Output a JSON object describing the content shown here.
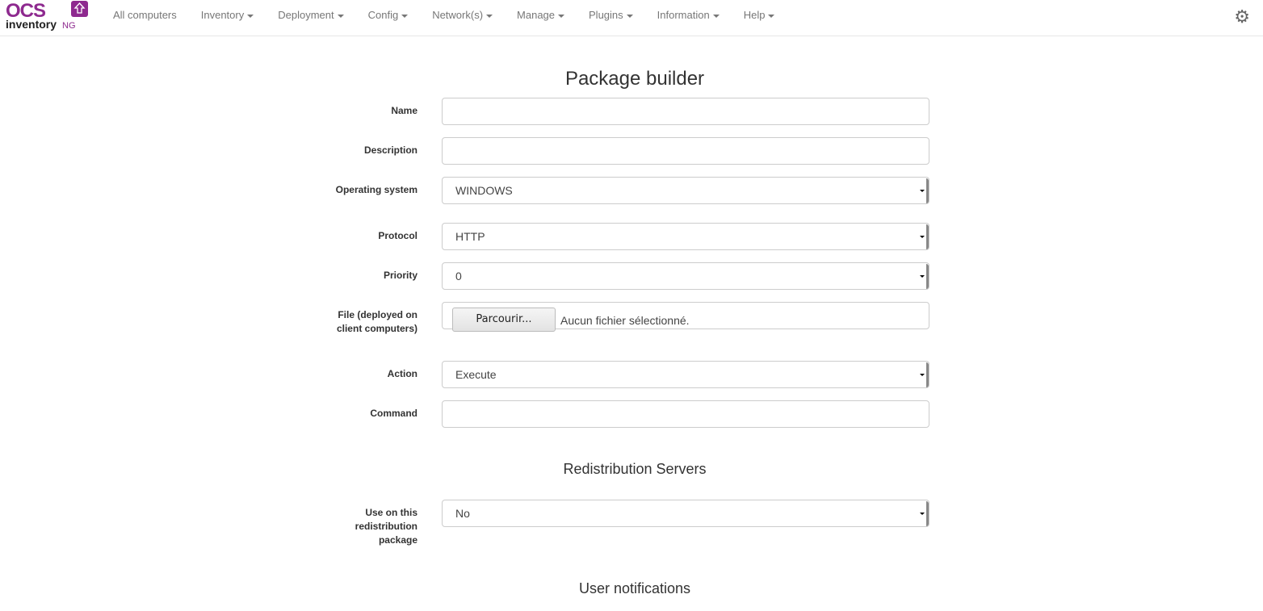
{
  "nav": {
    "logo_text": "OCS inventory NG",
    "items": [
      {
        "label": "All computers",
        "caret": false
      },
      {
        "label": "Inventory",
        "caret": true
      },
      {
        "label": "Deployment",
        "caret": true
      },
      {
        "label": "Config",
        "caret": true
      },
      {
        "label": "Network(s)",
        "caret": true
      },
      {
        "label": "Manage",
        "caret": true
      },
      {
        "label": "Plugins",
        "caret": true
      },
      {
        "label": "Information",
        "caret": true
      },
      {
        "label": "Help",
        "caret": true
      }
    ]
  },
  "page_title": "Package builder",
  "form": {
    "name": {
      "label": "Name",
      "value": ""
    },
    "description": {
      "label": "Description",
      "value": ""
    },
    "os": {
      "label": "Operating system",
      "value": "WINDOWS"
    },
    "protocol": {
      "label": "Protocol",
      "value": "HTTP"
    },
    "priority": {
      "label": "Priority",
      "value": "0"
    },
    "file": {
      "label": "File (deployed on client computers)",
      "button": "Parcourir...",
      "status": "Aucun fichier sélectionné."
    },
    "action": {
      "label": "Action",
      "value": "Execute"
    },
    "command": {
      "label": "Command",
      "value": ""
    }
  },
  "redistribution": {
    "title": "Redistribution Servers",
    "use": {
      "label": "Use on this redistribution package",
      "value": "No"
    }
  },
  "notifications": {
    "title": "User notifications"
  }
}
